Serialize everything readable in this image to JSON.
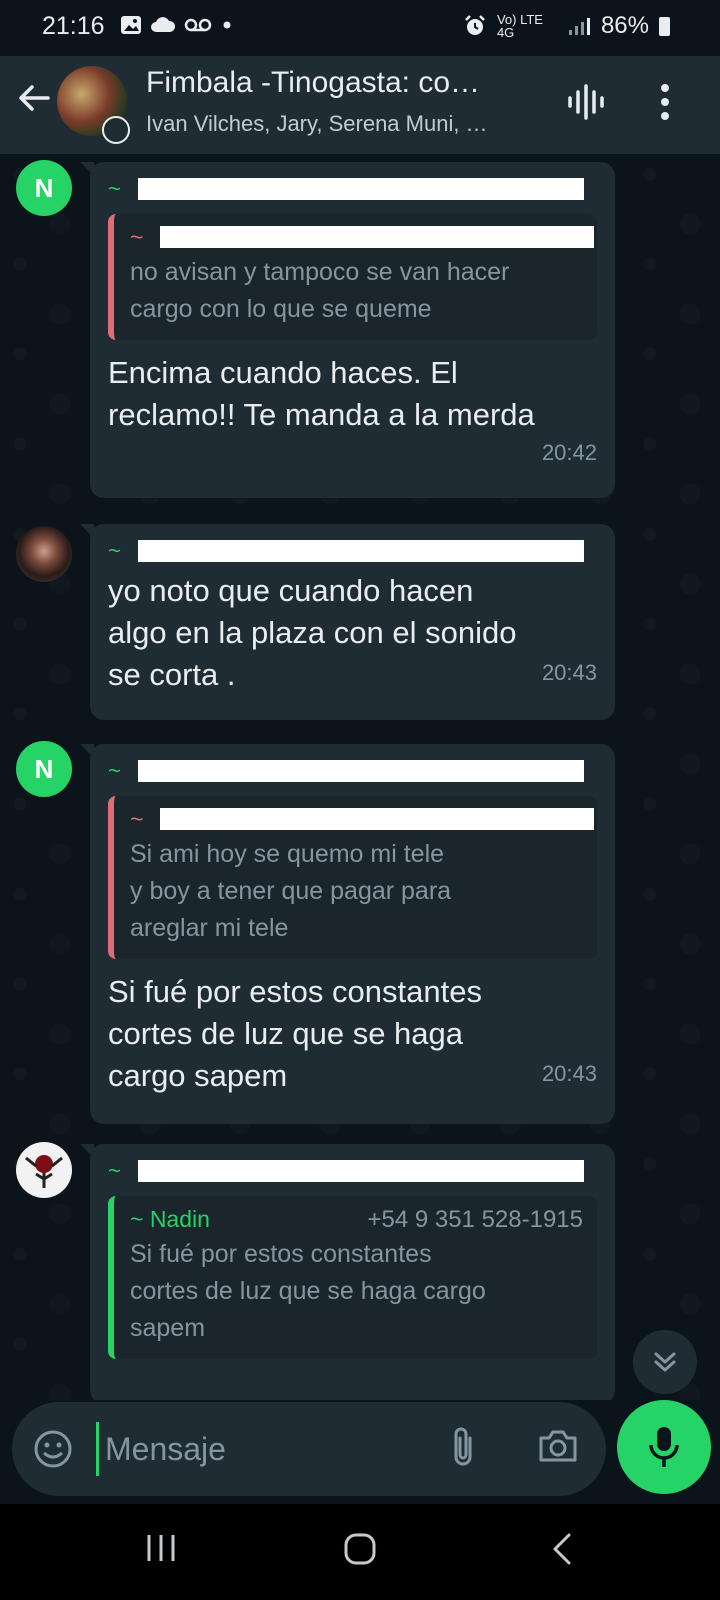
{
  "status_bar": {
    "time": "21:16",
    "network": "Vo) LTE 4G",
    "battery": "86%"
  },
  "header": {
    "title": "Fimbala -Tinogasta: co…",
    "subtitle": "Ivan Vilches, Jary, Serena Muni, …"
  },
  "messages": [
    {
      "avatar_letter": "N",
      "sender": "~",
      "quote": {
        "sender": "~",
        "phone": "",
        "text": "no avisan y tampoco se van hacer\ncargo con lo que se queme"
      },
      "text": "Encima cuando haces. El\nreclamo!! Te manda a la merda",
      "time": "20:42"
    },
    {
      "sender": "~",
      "text": "yo noto que cuando hacen\nalgo en la plaza con el sonido\nse corta .",
      "time": "20:43"
    },
    {
      "avatar_letter": "N",
      "sender": "~",
      "quote": {
        "sender": "~",
        "phone": "",
        "text": "Si ami hoy se quemo mi tele\ny boy a tener que pagar para\nareglar mi tele"
      },
      "text": "Si fué por estos constantes\ncortes de luz que se haga\ncargo sapem",
      "time": "20:43"
    },
    {
      "sender": "~",
      "quote": {
        "sender": "~ Nadin",
        "phone": "+54 9 351 528-1915",
        "text": "Si fué por estos constantes\ncortes de luz que se haga cargo\nsapem"
      }
    }
  ],
  "composer": {
    "placeholder": "Mensaje"
  },
  "colors": {
    "accent": "#25d366",
    "bubble": "#1f2c34",
    "background": "#0b141a",
    "quote_bar_red": "#e06c75"
  }
}
